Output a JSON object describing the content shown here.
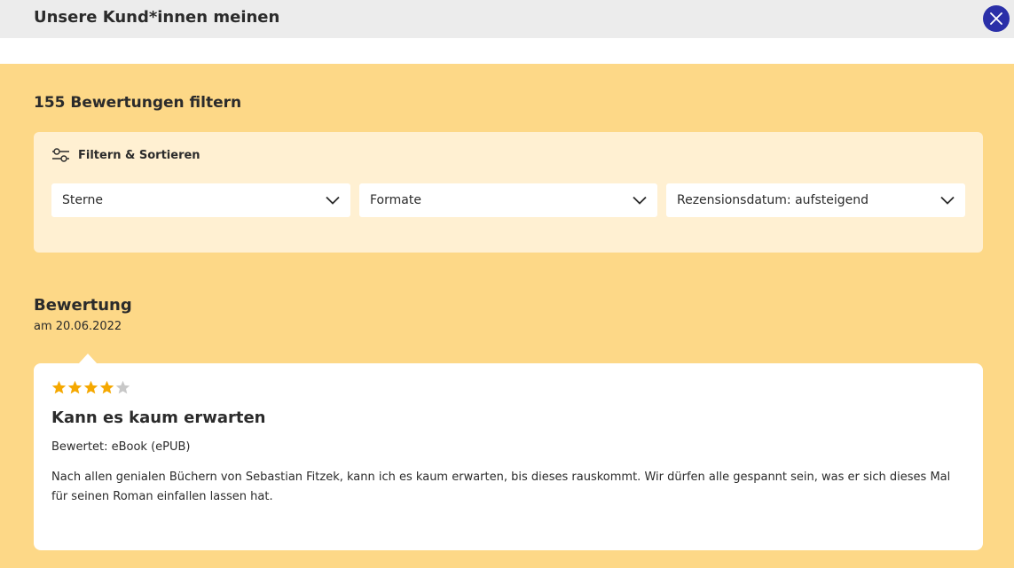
{
  "header": {
    "title": "Unsere Kund*innen meinen",
    "close_icon": "close-icon"
  },
  "filter": {
    "heading": "155 Bewertungen filtern",
    "toggle_label": "Filtern & Sortieren",
    "toggle_icon": "sliders-icon",
    "selects": [
      {
        "label": "Sterne"
      },
      {
        "label": "Formate"
      },
      {
        "label": "Rezensionsdatum: aufsteigend"
      }
    ]
  },
  "review": {
    "heading": "Bewertung",
    "date": "am 20.06.2022",
    "rating": 4,
    "rating_max": 5,
    "title": "Kann es kaum erwarten",
    "format": "Bewertet: eBook (ePUB)",
    "text": "Nach allen genialen Büchern von Sebastian Fitzek, kann ich es kaum erwarten, bis dieses rauskommt. Wir dürfen alle gespannt sein, was er sich dieses Mal für seinen Roman einfallen lassen hat."
  },
  "colors": {
    "background": "#fdd887",
    "filter_box": "#fff0d2",
    "close_button": "#2a2fa8",
    "star_filled": "#f5a800",
    "star_empty": "#c8c8c8"
  }
}
